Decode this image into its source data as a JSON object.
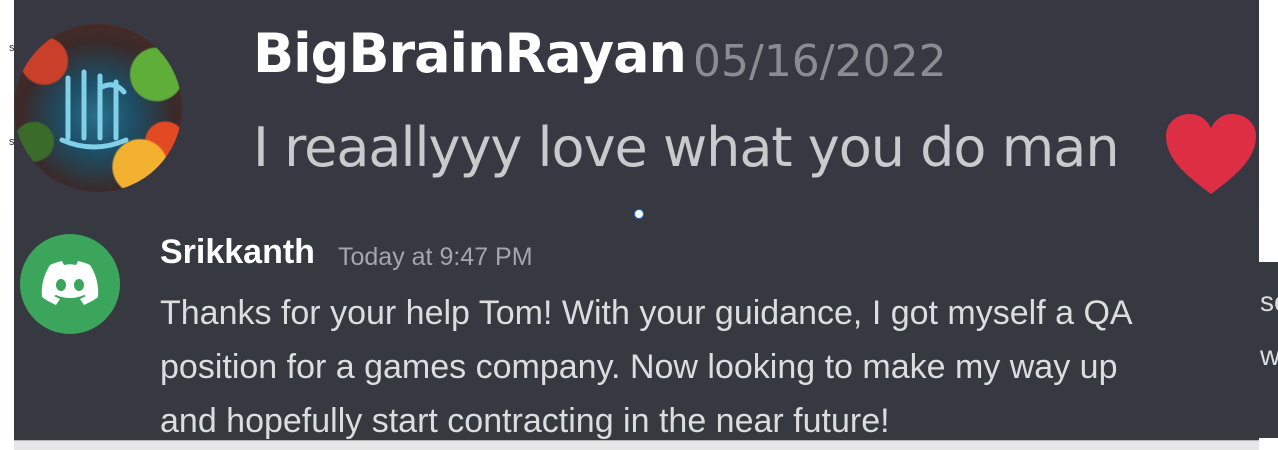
{
  "top_message": {
    "username": "BigBrainRayan",
    "timestamp": "05/16/2022",
    "text": "I reaallyyy love what you do man"
  },
  "bottom_message": {
    "username": "Srikkanth",
    "timestamp": "Today at 9:47 PM",
    "lines": [
      "Thanks for your help Tom! With your guidance, I got myself a QA",
      "position for a games company. Now looking to make my way up",
      "and hopefully start contracting in the near future!"
    ]
  },
  "background_fragments": {
    "left": [
      "s",
      "s"
    ],
    "right": [
      "se",
      "w"
    ]
  },
  "colors": {
    "top_panel_bg": "#383842",
    "bottom_panel_bg": "#36393f",
    "discord_green": "#3ba55c",
    "heart_red": "#dd2e44",
    "username_white": "#ffffff",
    "timestamp_gray": "#a3a6aa",
    "message_text": "#dcddde"
  },
  "icons": {
    "avatar_1": "calligraphy-avatar-icon",
    "avatar_2": "discord-logo-icon",
    "heart": "heart-emoji-icon"
  }
}
